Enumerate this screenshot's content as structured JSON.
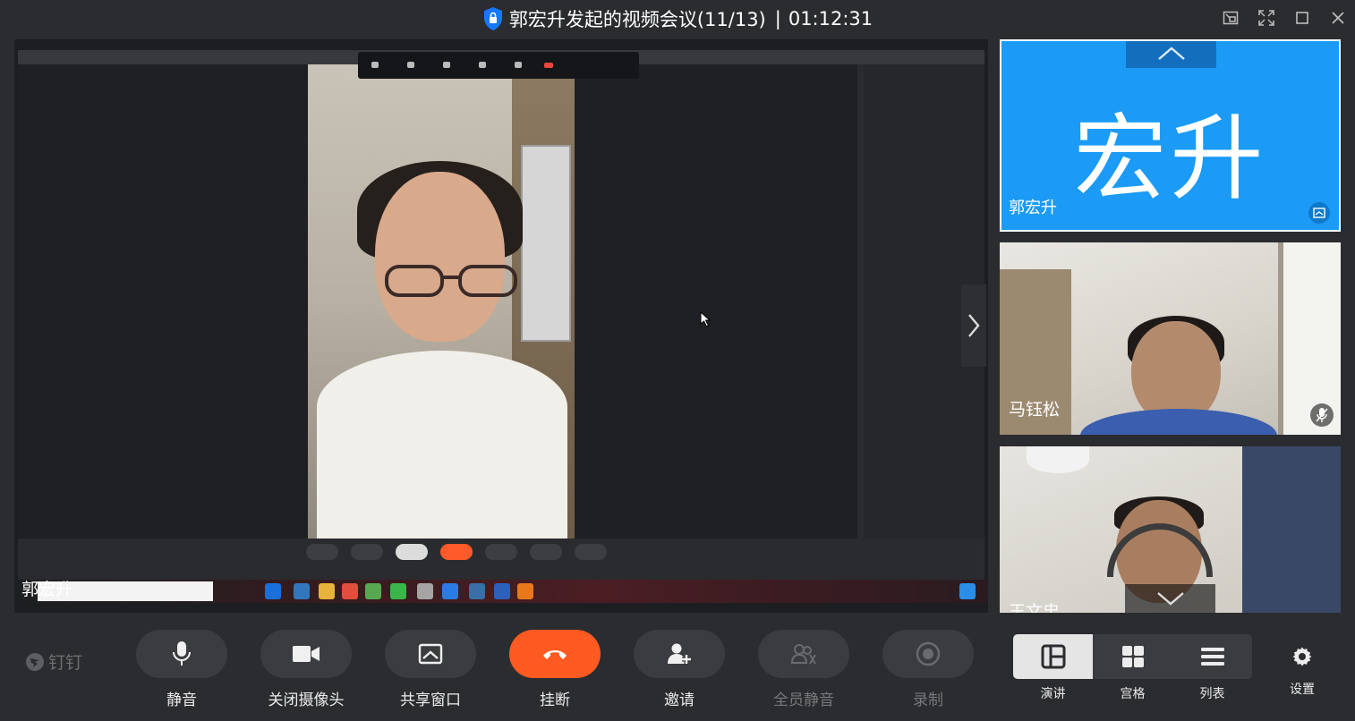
{
  "window": {
    "title": "郭宏升发起的视频会议(11/13)",
    "separator": "|",
    "duration": "01:12:31"
  },
  "main_stage": {
    "speaker_label": "郭宏升"
  },
  "participants": [
    {
      "tile_name": "宏升",
      "label": "郭宏升",
      "state": "avatar",
      "color": "#1b9bf6"
    },
    {
      "label": "马钰松",
      "state": "video",
      "mic": "muted"
    },
    {
      "label": "王文忠",
      "state": "video"
    }
  ],
  "toolbar": {
    "brand": "钉钉",
    "buttons": [
      {
        "id": "mute",
        "label": "静音",
        "icon": "microphone-icon"
      },
      {
        "id": "camera",
        "label": "关闭摄像头",
        "icon": "camera-icon"
      },
      {
        "id": "share",
        "label": "共享窗口",
        "icon": "share-window-icon"
      },
      {
        "id": "hangup",
        "label": "挂断",
        "icon": "phone-hangup-icon",
        "color": "#ff5a21"
      },
      {
        "id": "invite",
        "label": "邀请",
        "icon": "add-user-icon"
      },
      {
        "id": "mute_all",
        "label": "全员静音",
        "icon": "mute-all-icon",
        "disabled": true
      },
      {
        "id": "record",
        "label": "录制",
        "icon": "record-icon",
        "disabled": true
      }
    ],
    "layouts": [
      {
        "id": "speaker",
        "label": "演讲",
        "active": true
      },
      {
        "id": "grid",
        "label": "宫格"
      },
      {
        "id": "list",
        "label": "列表"
      }
    ],
    "settings_label": "设置"
  }
}
